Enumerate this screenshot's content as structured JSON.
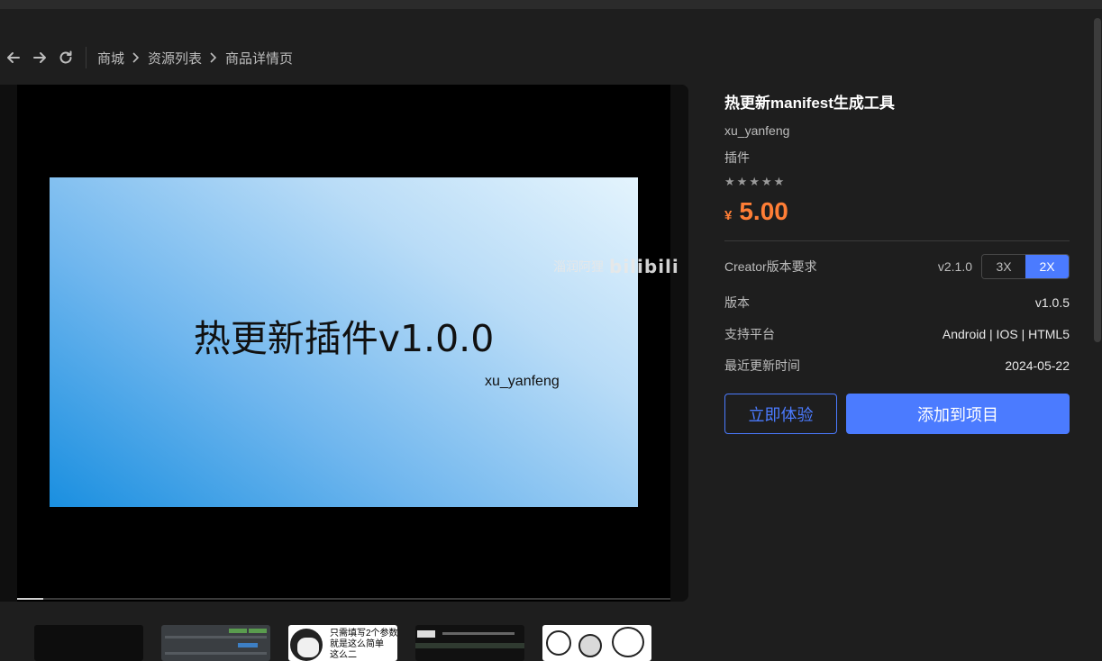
{
  "breadcrumb": [
    "商城",
    "资源列表",
    "商品详情页"
  ],
  "nav": {
    "back_icon": "arrow-left-icon",
    "forward_icon": "arrow-right-icon",
    "refresh_icon": "refresh-icon"
  },
  "player": {
    "slide_title": "热更新插件v1.0.0",
    "slide_author": "xu_yanfeng",
    "watermark_text": "淄润阿狸",
    "watermark_logo": "bilibili",
    "progress": 0.04
  },
  "product": {
    "title": "热更新manifest生成工具",
    "author": "xu_yanfeng",
    "category": "插件",
    "rating": 0,
    "rating_max": 5,
    "currency": "¥",
    "price": "5.00"
  },
  "specs": {
    "creator_label": "Creator版本要求",
    "creator_current": "v2.1.0",
    "creator_options": [
      "3X",
      "2X"
    ],
    "creator_selected": "2X",
    "version_label": "版本",
    "version_value": "v1.0.5",
    "platform_label": "支持平台",
    "platform_value": "Android | IOS | HTML5",
    "updated_label": "最近更新时间",
    "updated_value": "2024-05-22"
  },
  "actions": {
    "try_label": "立即体验",
    "add_label": "添加到项目"
  },
  "thumbnails": {
    "t2_text": "只需填写2个参数\n就是这么简单\n这么二"
  },
  "colors": {
    "accent": "#4b7bff",
    "price": "#ff7e36",
    "background": "#1e1e1e"
  }
}
